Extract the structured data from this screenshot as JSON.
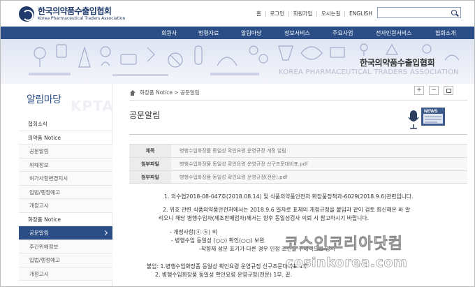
{
  "header": {
    "logo_ko": "한국의약품수출입협회",
    "logo_en": "Korea Pharmaceutical Traders Association",
    "links": [
      "홈",
      "로그인",
      "회원가입",
      "오시는길",
      "ENGLISH"
    ],
    "search_placeholder": ""
  },
  "nav": [
    "회원사",
    "법령자료",
    "알림마당",
    "정보서비스",
    "주요사업",
    "전자민원서비스",
    "협회소개"
  ],
  "banner": {
    "ko": "한국의약품수출입협회",
    "en": "KOREA PHARMACEUTICAL TRADERS ASSOCIATION"
  },
  "sidebar": {
    "title": "알림마당",
    "watermark": "KPTA",
    "items": [
      {
        "label": "협회소식",
        "sub": false,
        "active": false
      },
      {
        "label": "의약품 Notice",
        "sub": false,
        "active": false
      },
      {
        "label": "공문알림",
        "sub": true,
        "active": false
      },
      {
        "label": "위해정보",
        "sub": true,
        "active": false
      },
      {
        "label": "허가사항변경지시",
        "sub": true,
        "active": false
      },
      {
        "label": "입법/행정예고",
        "sub": true,
        "active": false
      },
      {
        "label": "개정고시",
        "sub": true,
        "active": false
      },
      {
        "label": "화장품 Notice",
        "sub": false,
        "active": false
      },
      {
        "label": "공문알림",
        "sub": true,
        "active": true
      },
      {
        "label": "주간위해정보",
        "sub": true,
        "active": false
      },
      {
        "label": "입법/행정예고",
        "sub": true,
        "active": false
      },
      {
        "label": "개정고시",
        "sub": true,
        "active": false
      }
    ]
  },
  "content": {
    "breadcrumb": "화장품 Notice > 공문알림",
    "tools": [
      "+",
      "−",
      "print-icon"
    ],
    "title": "공문알림",
    "news_label": "NEWS",
    "info": [
      {
        "label": "제목",
        "value": "병행수입화장품 동일성 확인요령 운영규정 개정 알림"
      },
      {
        "label": "첨부파일",
        "value": "병행수입화장품 동일성 확인요령 운영규정 신구조문대비표.pdf"
      },
      {
        "label": "첨부파일",
        "value": "병행수입화장품 동일성 확인요령 운영규정(전문).pdf"
      }
    ],
    "body": {
      "p1": "1.  의수협2018-08-047호(2018.08.14) 및 식품의약품안전처 화장품정책과-6029(2018.9.6)관련입니다.",
      "p2a": "2. 위호 관련 식품의약품안전처에서는 2018.9.6 일자로 표제의 개정규정을 붙임과 같이 검토 회신해온 바 알",
      "p2b": "리오니 해당 병행수입자(제조판매업자)께서는 향후 동일성검사 의뢰 시 참고하시기 바랍니다.",
      "b1": "- 개정사항(ⓐ ⓑ) 외",
      "b2": "- 병행수입 동일성 (○○) 확인(○○) 보완",
      "b3": "-착향제 성분 표기가 다른 경우 인정 조건을 구체적으로 명시",
      "b4": "붙임: 1.병행수입화장품 동일성 확인요령 운영규정 신구조문대비표 1부",
      "b5": "2. 병행수입화장품 동일성 확인요령 운영규정(전문) 1부. 끝."
    }
  },
  "watermark": {
    "ko": "코스인코리아닷컴",
    "en": "cosinkorea.com"
  },
  "colors": {
    "nav": "#2b4e86",
    "brand": "#1f3a6b",
    "active": "#2b4e86"
  }
}
